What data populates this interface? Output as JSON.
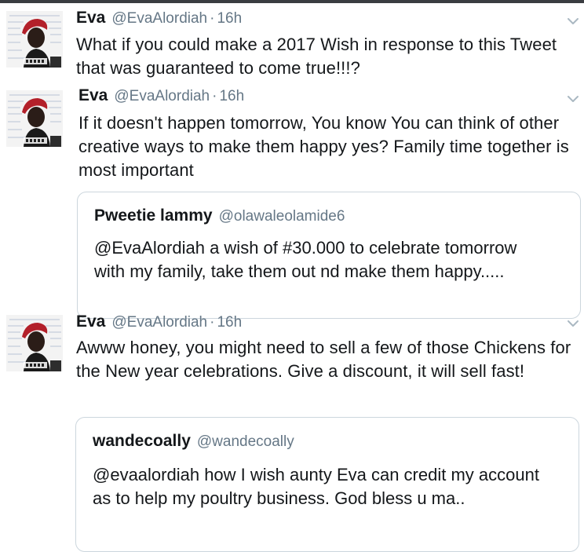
{
  "tweets": [
    {
      "name": "Eva",
      "handle": "@EvaAlordiah",
      "separator": "·",
      "time": "16h",
      "text": "What if you could make a 2017 Wish in response to this Tweet that was guaranteed to come true!!!?"
    },
    {
      "name": "Eva",
      "handle": "@EvaAlordiah",
      "separator": "·",
      "time": "16h",
      "text": "If it doesn't happen tomorrow, You know You can think of other creative ways to make them happy yes? Family time together is most important",
      "quote": {
        "name": "Pweetie lammy",
        "handle": "@olawaleolamide6",
        "text": "@EvaAlordiah a wish of #30.000 to celebrate tomorrow with my family, take them out nd make them happy....."
      }
    },
    {
      "name": "Eva",
      "handle": "@EvaAlordiah",
      "separator": "·",
      "time": "16h",
      "text": "Awww honey, you might need to sell a few of those Chickens for the New year celebrations. Give a discount, it will sell fast!",
      "quote": {
        "name": "wandecoally",
        "handle": "@wandecoally",
        "text": "@evaalordiah how I wish aunty Eva can credit my account as to help my poultry business. God bless u ma.."
      }
    }
  ],
  "icons": {
    "menu": "chevron-down-icon",
    "avatar": "avatar"
  },
  "colors": {
    "text": "#14171a",
    "secondary": "#657786",
    "border": "#ccd6dd",
    "chevron": "#aab8c2",
    "avatar_hair": "#b3202a"
  }
}
